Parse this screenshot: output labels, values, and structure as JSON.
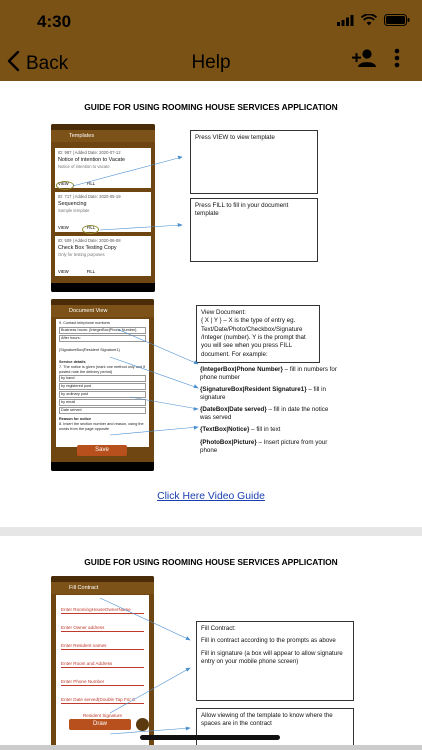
{
  "status": {
    "time": "4:30"
  },
  "nav": {
    "back_label": "Back",
    "title": "Help"
  },
  "colors": {
    "nav_bar": "#7a5216",
    "link": "#1a3fb0",
    "field_red": "#c0392b"
  },
  "icons": [
    "chevron-left-icon",
    "add-person-icon",
    "more-vertical-icon",
    "wifi-icon",
    "battery-icon",
    "signal-icon"
  ],
  "page1": {
    "title": "GUIDE FOR USING ROOMING HOUSE SERVICES APPLICATION",
    "phone1": {
      "bar_title": "Templates",
      "cards": [
        {
          "meta": "ID: 987 | Added Date: 2020-07-12",
          "title": "Notice of intention to Vacate",
          "sub": "Notice of intention to vacate",
          "view": "VIEW",
          "fill": "FILL"
        },
        {
          "meta": "ID: 717 | Added Date: 2020-05-19",
          "title": "Sequencing",
          "sub": "Sample template",
          "view": "VIEW",
          "fill": "FILL"
        },
        {
          "meta": "ID: 509 | Added Date: 2020-06-08",
          "title": "Check Box Testing Copy",
          "sub": "Only for testing purposes",
          "view": "VIEW",
          "fill": "FILL"
        }
      ]
    },
    "callout_view": "Press VIEW to view template",
    "callout_fill": "Press FILL to fill in your document template",
    "phone2": {
      "bar_title": "Document View",
      "lines": [
        "9. Contact telephone numbers",
        "Business hours: {IntegerBox|Phone Number}",
        "After hours:",
        "{SignatureBox|Resident Signature1}",
        "Service details",
        "7. The notice is given (mark one method only and if posted note the delivery period)",
        "by hand",
        "by registered post",
        "by ordinary post",
        "by email",
        "Date served",
        "Reason for notice",
        "8. Insert the section number and reason, using the words from the page opposite"
      ],
      "draw_label": "Save"
    },
    "doc_info": {
      "heading": "View Document:",
      "syntax": "{ X | Y } – X is the type of entry eg. Text/Date/Photo/Checkbox/Signature /Integer (number). Y is the prompt that you will see when you press FILL document. For example:",
      "examples": [
        {
          "code": "{IntegerBox|Phone Number}",
          "desc": "– fill in numbers for phone number"
        },
        {
          "code": "{SignatureBox|Resident Signature1}",
          "desc": "– fill in signature"
        },
        {
          "code": "{DateBox|Date served}",
          "desc": "– fill in date the notice was served"
        },
        {
          "code": "{TextBox|Notice}",
          "desc": "– fill in text"
        },
        {
          "code": "{PhotoBox|Picture}",
          "desc": "– Insert picture from your phone"
        }
      ]
    },
    "video_link": "Click Here Video Guide"
  },
  "page2": {
    "title": "GUIDE FOR USING ROOMING HOUSE SERVICES APPLICATION",
    "phone": {
      "bar_title": "Fill Contract",
      "fields": [
        "Enter RoomingHouseOwnerName",
        "Enter Owner address",
        "Enter Resident names",
        "Enter Room and Address",
        "Enter Phone Number",
        "Enter Date served(Double Tap For C",
        "Resident Signature"
      ],
      "draw_label": "Draw"
    },
    "callout_fill": {
      "heading": "Fill Contract:",
      "p1": "Fill in contract according to the prompts as above",
      "p2": "Fill in signature (a box will appear to allow signature entry on your mobile phone screen)"
    },
    "callout_view": "Allow viewing of the template to know where the spaces are in the contract"
  }
}
